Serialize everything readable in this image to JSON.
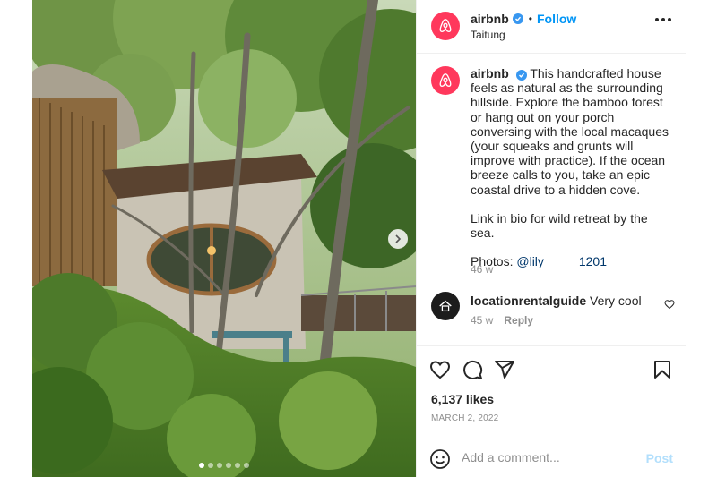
{
  "header": {
    "username": "airbnb",
    "dot": "•",
    "follow_label": "Follow",
    "location": "Taitung",
    "avatar_icon": "airbnb-logo-icon",
    "verified_icon": "verified-badge-icon",
    "more_icon": "more-options-icon"
  },
  "caption": {
    "username": "airbnb",
    "text_1": "This handcrafted house feels as natural as the surrounding hillside. Explore the bamboo forest or hang out on your porch conversing with the local macaques (your squeaks and grunts will improve with practice). If the ocean breeze calls to you, take an epic coastal drive to a hidden cove.",
    "text_2": "Link in bio for wild retreat by the sea.",
    "photos_prefix": "Photos: ",
    "photos_mention": "@lily_____1201",
    "time": "46 w"
  },
  "comment": {
    "username": "locationrentalguide",
    "text": "Very cool",
    "time": "45 w",
    "reply_label": "Reply",
    "like_icon": "heart-outline-icon"
  },
  "actions": {
    "like_icon": "heart-icon",
    "comment_icon": "comment-icon",
    "share_icon": "send-icon",
    "save_icon": "bookmark-icon"
  },
  "likes": "6,137 likes",
  "date": "MARCH 2, 2022",
  "add_comment": {
    "placeholder": "Add a comment...",
    "post_label": "Post",
    "emoji_icon": "emoji-icon"
  },
  "carousel": {
    "next_icon": "chevron-right-icon",
    "dot_count": 6,
    "active_index": 0
  },
  "colors": {
    "brand": "#ff385c",
    "link": "#0095f6",
    "mention": "#00376b",
    "muted": "#8e8e8e",
    "post_disabled": "#b2dffc"
  }
}
